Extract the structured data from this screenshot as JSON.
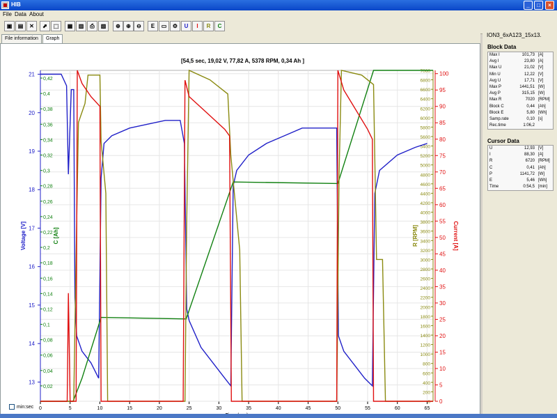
{
  "window": {
    "title": "HIB",
    "min_label": "_",
    "max_label": "□",
    "close_label": "×"
  },
  "menu": [
    "File",
    "Data",
    "About"
  ],
  "toolbar": {
    "buttons": [
      {
        "name": "open-folder-icon",
        "glyph": "▣"
      },
      {
        "name": "save-icon",
        "glyph": "▤"
      },
      {
        "name": "delete-icon",
        "glyph": "✕"
      },
      {
        "name": "cursor-icon",
        "glyph": "⬈"
      },
      {
        "name": "select-icon",
        "glyph": "⬚"
      },
      {
        "name": "copy-icon",
        "glyph": "▦"
      },
      {
        "name": "print-preview-icon",
        "glyph": "▥"
      },
      {
        "name": "print-icon",
        "glyph": "⎙"
      },
      {
        "name": "export-icon",
        "glyph": "▧"
      },
      {
        "name": "zoom-icon",
        "glyph": "⊕"
      },
      {
        "name": "zoom-in-icon",
        "glyph": "⊕"
      },
      {
        "name": "zoom-out-icon",
        "glyph": "⊖"
      },
      {
        "name": "e-icon",
        "glyph": "E"
      },
      {
        "name": "window-icon",
        "glyph": "▭"
      },
      {
        "name": "settings-icon",
        "glyph": "⚙"
      },
      {
        "name": "toggle-u-button",
        "glyph": "U"
      },
      {
        "name": "toggle-i-button",
        "glyph": "I"
      },
      {
        "name": "toggle-r-button",
        "glyph": "R"
      },
      {
        "name": "toggle-c-button",
        "glyph": "C"
      }
    ]
  },
  "tabs": [
    "File information",
    "Graph"
  ],
  "cursor_readout": "[54,5 sec, 19,02 V, 77,82 A, 5378 RPM, 0,34 Ah ]",
  "minsec_label": "min:sec",
  "file_name": "ION3_6xA123_15x13.",
  "block_data": {
    "title": "Block Data",
    "rows": [
      {
        "label": "Max I",
        "value": "101,73",
        "unit": "[A]"
      },
      {
        "label": "Avg I",
        "value": "23,80",
        "unit": "[A]"
      },
      {
        "label": "Max U",
        "value": "21,02",
        "unit": "[V]"
      },
      {
        "label": "Min U",
        "value": "12,22",
        "unit": "[V]"
      },
      {
        "label": "Avg U",
        "value": "17,71",
        "unit": "[V]"
      },
      {
        "label": "Max P",
        "value": "1441,51",
        "unit": "[W]"
      },
      {
        "label": "Avg P",
        "value": "315,15",
        "unit": "[W]"
      },
      {
        "label": "Max R",
        "value": "7020",
        "unit": "[RPM]"
      },
      {
        "label": "Block C",
        "value": "0,44",
        "unit": "[Ah]"
      },
      {
        "label": "Block E",
        "value": "5,80",
        "unit": "[Wh]"
      },
      {
        "label": "Samp.rate",
        "value": "0,10",
        "unit": "[s]"
      },
      {
        "label": "Rec.time",
        "value": "1:06,2",
        "unit": ""
      }
    ]
  },
  "cursor_data": {
    "title": "Cursor Data",
    "rows": [
      {
        "label": "U",
        "value": "12,93",
        "unit": "[V]"
      },
      {
        "label": "I",
        "value": "88,30",
        "unit": "[A]"
      },
      {
        "label": "R",
        "value": "6720",
        "unit": "[RPM]"
      },
      {
        "label": "C",
        "value": "0,41",
        "unit": "[Ah]"
      },
      {
        "label": "P",
        "value": "1141,72",
        "unit": "[W]"
      },
      {
        "label": "E",
        "value": "5,46",
        "unit": "[Wh]"
      },
      {
        "label": "Time",
        "value": "0:54,5",
        "unit": "[min]"
      }
    ]
  },
  "colors": {
    "voltage": "#2020c8",
    "capacity": "#108010",
    "rpm": "#8a8a10",
    "current": "#e01010",
    "grid": "#e6e6e6"
  },
  "chart_data": {
    "type": "line",
    "xlabel": "Time (sec)",
    "xlim": [
      0,
      66
    ],
    "x_ticks": [
      0,
      5,
      10,
      15,
      20,
      25,
      30,
      35,
      40,
      45,
      50,
      55,
      60,
      65
    ],
    "axes": {
      "voltage": {
        "label": "Voltage [V]",
        "lim": [
          12.5,
          21.1
        ],
        "ticks": [
          13,
          14,
          15,
          16,
          17,
          18,
          19,
          20,
          21
        ]
      },
      "capacity": {
        "label": "C [Ah]",
        "lim": [
          0,
          0.43
        ],
        "ticks": [
          "0,02",
          "0,04",
          "0,06",
          "0,08",
          "0,1",
          "0,12",
          "0,14",
          "0,16",
          "0,18",
          "0,2",
          "0,22",
          "0,24",
          "0,26",
          "0,28",
          "0,3",
          "0,32",
          "0,34",
          "0,36",
          "0,38",
          "0,4",
          "0,42"
        ]
      },
      "rpm": {
        "label": "R [RPM]",
        "lim": [
          0,
          7000
        ],
        "ticks": [
          0,
          200,
          400,
          600,
          800,
          1000,
          1200,
          1400,
          1600,
          1800,
          2000,
          2200,
          2400,
          2600,
          2800,
          3000,
          3200,
          3400,
          3600,
          3800,
          4000,
          4200,
          4400,
          4600,
          4800,
          5000,
          5200,
          5400,
          5600,
          5800,
          6000,
          6200,
          6400,
          6600,
          6800,
          7000
        ]
      },
      "current": {
        "label": "Current [A]",
        "lim": [
          0,
          101
        ],
        "ticks": [
          0,
          5,
          10,
          15,
          20,
          25,
          30,
          35,
          40,
          45,
          50,
          55,
          60,
          65,
          70,
          75,
          80,
          85,
          90,
          95,
          100
        ]
      }
    },
    "series": [
      {
        "name": "Voltage [V]",
        "axis": "voltage",
        "points": [
          [
            0,
            21
          ],
          [
            3.5,
            21
          ],
          [
            4.4,
            20.7
          ],
          [
            4.7,
            18.4
          ],
          [
            5.2,
            20.6
          ],
          [
            5.6,
            20.6
          ],
          [
            5.8,
            15.2
          ],
          [
            6.1,
            14.2
          ],
          [
            7,
            13.8
          ],
          [
            8.5,
            13.5
          ],
          [
            9.8,
            13.1
          ],
          [
            10.2,
            18.3
          ],
          [
            10.7,
            19.2
          ],
          [
            12,
            19.4
          ],
          [
            15,
            19.6
          ],
          [
            18,
            19.7
          ],
          [
            21,
            19.8
          ],
          [
            23.5,
            19.8
          ],
          [
            24.2,
            19.2
          ],
          [
            24.6,
            14.9
          ],
          [
            25,
            14.6
          ],
          [
            27,
            13.9
          ],
          [
            29,
            13.5
          ],
          [
            31,
            13.1
          ],
          [
            32,
            12.9
          ],
          [
            32.4,
            18.1
          ],
          [
            33,
            18.5
          ],
          [
            35,
            18.9
          ],
          [
            38,
            19.2
          ],
          [
            41,
            19.4
          ],
          [
            44,
            19.6
          ],
          [
            47,
            19.6
          ],
          [
            49.8,
            19.6
          ],
          [
            50.1,
            14.2
          ],
          [
            51,
            13.8
          ],
          [
            53,
            13.4
          ],
          [
            54.5,
            13.1
          ],
          [
            55.8,
            12.9
          ],
          [
            56.2,
            17.9
          ],
          [
            57,
            18.5
          ],
          [
            60,
            18.9
          ],
          [
            63,
            19.1
          ],
          [
            65,
            19.2
          ]
        ]
      },
      {
        "name": "C [Ah]",
        "axis": "capacity",
        "points": [
          [
            0,
            0
          ],
          [
            5.5,
            0
          ],
          [
            7,
            0.03
          ],
          [
            10.2,
            0.109
          ],
          [
            24.5,
            0.107
          ],
          [
            32.4,
            0.285
          ],
          [
            50,
            0.283
          ],
          [
            56,
            0.43
          ],
          [
            66,
            0.43
          ]
        ]
      },
      {
        "name": "R [RPM]",
        "axis": "rpm",
        "points": [
          [
            0,
            0
          ],
          [
            5.6,
            0
          ],
          [
            6,
            3100
          ],
          [
            6.4,
            5900
          ],
          [
            7.5,
            6300
          ],
          [
            8,
            6900
          ],
          [
            10,
            6900
          ],
          [
            10.2,
            5500
          ],
          [
            11,
            4400
          ],
          [
            11.3,
            0
          ],
          [
            12,
            0
          ],
          [
            24.3,
            0
          ],
          [
            24.6,
            3800
          ],
          [
            25,
            7000
          ],
          [
            28.5,
            6800
          ],
          [
            31.5,
            6500
          ],
          [
            32,
            5200
          ],
          [
            33.5,
            3200
          ],
          [
            33.9,
            0
          ],
          [
            49.8,
            0
          ],
          [
            50.2,
            4800
          ],
          [
            50.6,
            7000
          ],
          [
            54,
            6900
          ],
          [
            56,
            6700
          ],
          [
            56.5,
            3000
          ],
          [
            57.5,
            3000
          ],
          [
            58,
            0
          ],
          [
            66,
            0
          ]
        ]
      },
      {
        "name": "Current [A]",
        "axis": "current",
        "points": [
          [
            0,
            0
          ],
          [
            4.5,
            0
          ],
          [
            4.7,
            33
          ],
          [
            5,
            0
          ],
          [
            6,
            0
          ],
          [
            6.2,
            101
          ],
          [
            7,
            97
          ],
          [
            8.5,
            93
          ],
          [
            10,
            90
          ],
          [
            10.2,
            0
          ],
          [
            24,
            0
          ],
          [
            24.3,
            98
          ],
          [
            25,
            93
          ],
          [
            28,
            88
          ],
          [
            31,
            83
          ],
          [
            31.8,
            81
          ],
          [
            32.1,
            0
          ],
          [
            49.8,
            0
          ],
          [
            50,
            101
          ],
          [
            51,
            95
          ],
          [
            53,
            89
          ],
          [
            55,
            83
          ],
          [
            55.8,
            80
          ],
          [
            56,
            0
          ],
          [
            66,
            0
          ]
        ]
      }
    ]
  }
}
